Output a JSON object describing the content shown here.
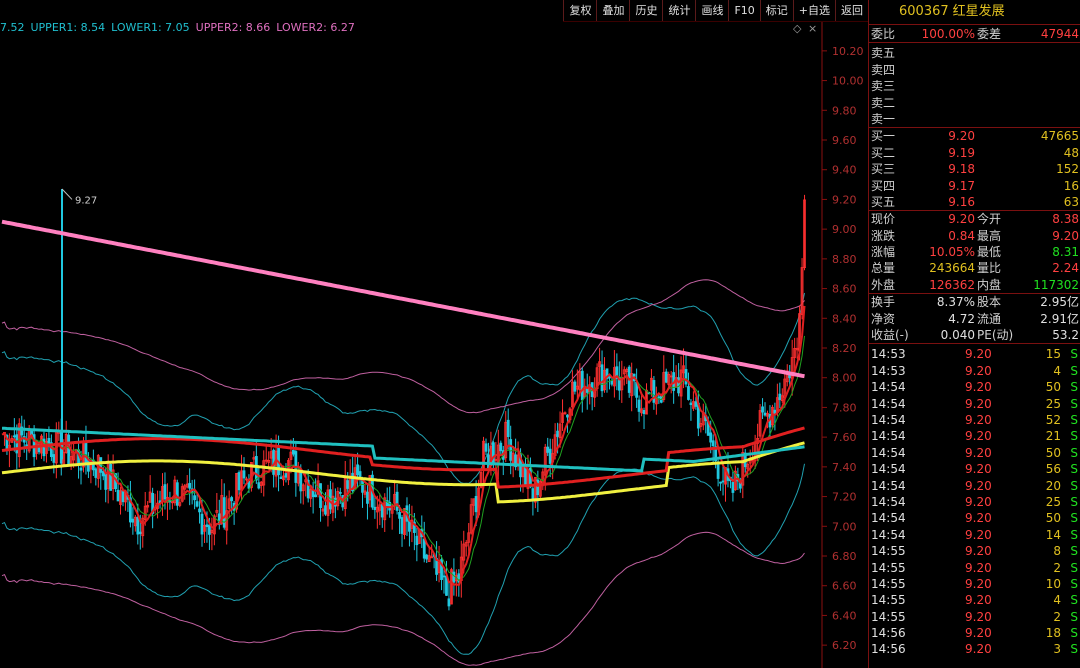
{
  "toolbar": [
    "复权",
    "叠加",
    "历史",
    "统计",
    "画线",
    "F10",
    "标记",
    "+自选",
    "返回"
  ],
  "indicator": {
    "items": [
      {
        "text": "7.52",
        "color": "#20c0d0"
      },
      {
        "text": "UPPER1: 8.54",
        "color": "#20c0d0"
      },
      {
        "text": "LOWER1: 7.05",
        "color": "#20c0d0"
      },
      {
        "text": "UPPER2: 8.66",
        "color": "#e070c0"
      },
      {
        "text": "LOWER2: 6.27",
        "color": "#e070c0"
      }
    ]
  },
  "chart_data": {
    "type": "candlestick",
    "y_axis_ticks": [
      "10.20",
      "10.00",
      "9.80",
      "9.60",
      "9.40",
      "9.20",
      "9.00",
      "8.80",
      "8.60",
      "8.40",
      "8.20",
      "8.00",
      "7.80",
      "7.60",
      "7.40",
      "7.20",
      "7.00",
      "6.80",
      "6.60",
      "6.40",
      "6.20"
    ],
    "ylim": [
      6.1,
      10.3
    ],
    "high_marker": "9.27",
    "colors": {
      "up": "#ff3030",
      "down": "#20c8e0",
      "ma_pink": "#ff80c0",
      "ma_cyan": "#20c0c0",
      "ma_red": "#e02020",
      "ma_yellow": "#f0f040",
      "ma_green": "#20a020",
      "band_cyan": "#20a0b0",
      "band_pink": "#c060a0"
    }
  },
  "panel": {
    "code": "600367",
    "name": "红星发展",
    "weibi_label": "委比",
    "weibi": "100.00%",
    "weicha_label": "委差",
    "weicha": "47944",
    "asks": [
      "卖五",
      "卖四",
      "卖三",
      "卖二",
      "卖一"
    ],
    "bids": [
      {
        "label": "买一",
        "price": "9.20",
        "vol": "47665"
      },
      {
        "label": "买二",
        "price": "9.19",
        "vol": "48"
      },
      {
        "label": "买三",
        "price": "9.18",
        "vol": "152"
      },
      {
        "label": "买四",
        "price": "9.17",
        "vol": "16"
      },
      {
        "label": "买五",
        "price": "9.16",
        "vol": "63"
      }
    ],
    "stats": [
      {
        "l1": "现价",
        "v1": "9.20",
        "c1": "red",
        "l2": "今开",
        "v2": "8.38",
        "c2": "red"
      },
      {
        "l1": "涨跌",
        "v1": "0.84",
        "c1": "red",
        "l2": "最高",
        "v2": "9.20",
        "c2": "red"
      },
      {
        "l1": "涨幅",
        "v1": "10.05%",
        "c1": "red",
        "l2": "最低",
        "v2": "8.31",
        "c2": "green"
      },
      {
        "l1": "总量",
        "v1": "243664",
        "c1": "yellow",
        "l2": "量比",
        "v2": "2.24",
        "c2": "red"
      },
      {
        "l1": "外盘",
        "v1": "126362",
        "c1": "red",
        "l2": "内盘",
        "v2": "117302",
        "c2": "green"
      }
    ],
    "stats2": [
      {
        "l1": "换手",
        "v1": "8.37%",
        "l2": "股本",
        "v2": "2.95亿"
      },
      {
        "l1": "净资",
        "v1": "4.72",
        "l2": "流通",
        "v2": "2.91亿"
      },
      {
        "l1": "收益(-)",
        "v1": "0.040",
        "l2": "PE(动)",
        "v2": "53.2"
      }
    ],
    "trades": [
      {
        "time": "14:53",
        "price": "9.20",
        "vol": "15",
        "bs": "S"
      },
      {
        "time": "14:53",
        "price": "9.20",
        "vol": "4",
        "bs": "S"
      },
      {
        "time": "14:54",
        "price": "9.20",
        "vol": "50",
        "bs": "S"
      },
      {
        "time": "14:54",
        "price": "9.20",
        "vol": "25",
        "bs": "S"
      },
      {
        "time": "14:54",
        "price": "9.20",
        "vol": "52",
        "bs": "S"
      },
      {
        "time": "14:54",
        "price": "9.20",
        "vol": "21",
        "bs": "S"
      },
      {
        "time": "14:54",
        "price": "9.20",
        "vol": "50",
        "bs": "S"
      },
      {
        "time": "14:54",
        "price": "9.20",
        "vol": "56",
        "bs": "S"
      },
      {
        "time": "14:54",
        "price": "9.20",
        "vol": "20",
        "bs": "S"
      },
      {
        "time": "14:54",
        "price": "9.20",
        "vol": "25",
        "bs": "S"
      },
      {
        "time": "14:54",
        "price": "9.20",
        "vol": "50",
        "bs": "S"
      },
      {
        "time": "14:54",
        "price": "9.20",
        "vol": "14",
        "bs": "S"
      },
      {
        "time": "14:55",
        "price": "9.20",
        "vol": "8",
        "bs": "S"
      },
      {
        "time": "14:55",
        "price": "9.20",
        "vol": "2",
        "bs": "S"
      },
      {
        "time": "14:55",
        "price": "9.20",
        "vol": "10",
        "bs": "S"
      },
      {
        "time": "14:55",
        "price": "9.20",
        "vol": "4",
        "bs": "S"
      },
      {
        "time": "14:55",
        "price": "9.20",
        "vol": "2",
        "bs": "S"
      },
      {
        "time": "14:56",
        "price": "9.20",
        "vol": "18",
        "bs": "S"
      },
      {
        "time": "14:56",
        "price": "9.20",
        "vol": "3",
        "bs": "S"
      }
    ]
  }
}
